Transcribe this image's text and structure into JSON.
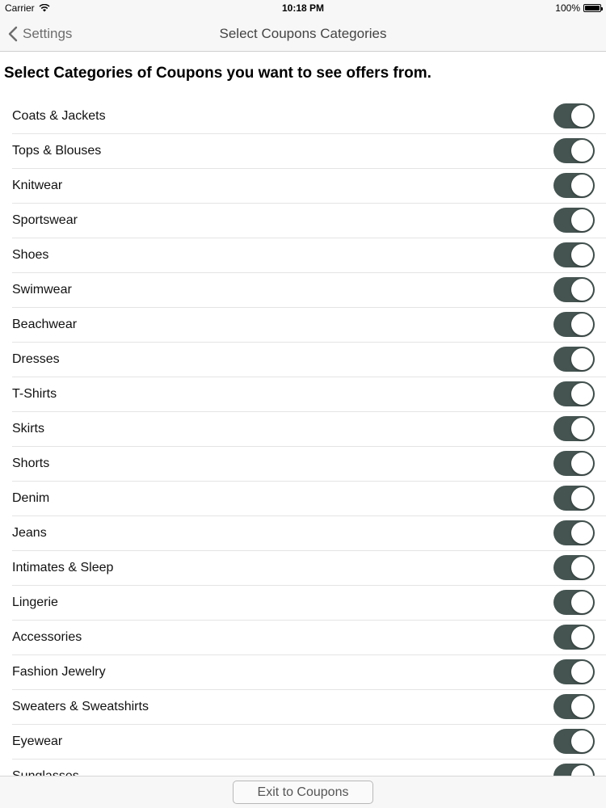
{
  "status_bar": {
    "carrier": "Carrier",
    "time": "10:18 PM",
    "battery": "100%"
  },
  "nav": {
    "back_label": "Settings",
    "title": "Select Coupons Categories"
  },
  "heading": "Select Categories of Coupons you want to see offers from.",
  "categories": [
    {
      "label": "Coats & Jackets",
      "on": true
    },
    {
      "label": "Tops & Blouses",
      "on": true
    },
    {
      "label": "Knitwear",
      "on": true
    },
    {
      "label": "Sportswear",
      "on": true
    },
    {
      "label": "Shoes",
      "on": true
    },
    {
      "label": "Swimwear",
      "on": true
    },
    {
      "label": "Beachwear",
      "on": true
    },
    {
      "label": "Dresses",
      "on": true
    },
    {
      "label": "T-Shirts",
      "on": true
    },
    {
      "label": "Skirts",
      "on": true
    },
    {
      "label": "Shorts",
      "on": true
    },
    {
      "label": "Denim",
      "on": true
    },
    {
      "label": "Jeans",
      "on": true
    },
    {
      "label": "Intimates & Sleep",
      "on": true
    },
    {
      "label": "Lingerie",
      "on": true
    },
    {
      "label": "Accessories",
      "on": true
    },
    {
      "label": "Fashion Jewelry",
      "on": true
    },
    {
      "label": "Sweaters & Sweatshirts",
      "on": true
    },
    {
      "label": "Eyewear",
      "on": true
    },
    {
      "label": "Sunglasses",
      "on": true
    }
  ],
  "colors": {
    "toggle_on": "#455451"
  },
  "bottom": {
    "exit_label": "Exit to Coupons"
  }
}
